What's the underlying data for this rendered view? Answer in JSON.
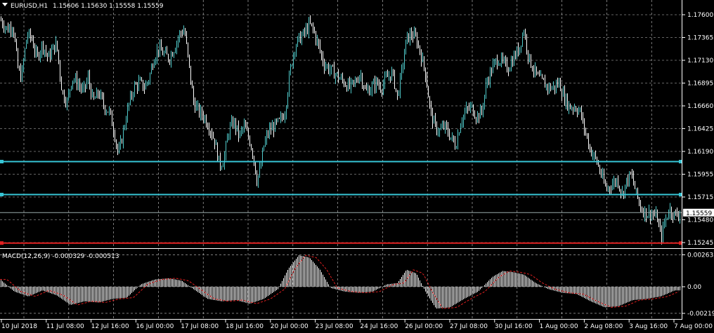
{
  "window": {
    "symbol_label": "EURUSD,H1",
    "ohlc": "1.15606 1.15630 1.15558 1.15559",
    "menu_icon": "triangle-down-icon",
    "bid_label": "1.15559"
  },
  "colors": {
    "background": "#000000",
    "grid": "#c8c8c8",
    "bull_candle": "#4fc9c9",
    "bear_candle": "#ffffff",
    "hline_cyan": "#37c6d6",
    "hline_red": "#e02020",
    "histogram": "#ffffff",
    "signal": "#e02020"
  },
  "price_axis": {
    "ticks": [
      "1.17600",
      "1.17365",
      "1.17130",
      "1.16895",
      "1.16660",
      "1.16425",
      "1.16190",
      "1.15955",
      "1.15715",
      "1.15480",
      "1.15245"
    ]
  },
  "horizontal_lines": [
    {
      "name": "hline-1",
      "price": 1.16085
    },
    {
      "name": "hline-2",
      "price": 1.15745
    },
    {
      "name": "hline-3",
      "price": 1.15245
    }
  ],
  "indicator": {
    "label": "MACD(12,26,9) -0.000329 -0.000513",
    "ticks": [
      "0.002633",
      "0.00",
      "-0.002194"
    ]
  },
  "time_axis": {
    "labels": [
      "10 Jul 2018",
      "11 Jul 08:00",
      "12 Jul 16:00",
      "16 Jul 00:00",
      "17 Jul 08:00",
      "18 Jul 16:00",
      "20 Jul 00:00",
      "23 Jul 08:00",
      "24 Jul 16:00",
      "26 Jul 00:00",
      "27 Jul 08:00",
      "30 Jul 16:00",
      "1 Aug 00:00",
      "2 Aug 08:00",
      "3 Aug 16:00",
      "7 Aug 00:00"
    ]
  },
  "price_path": [
    [
      0,
      1.1755
    ],
    [
      10,
      1.1745
    ],
    [
      18,
      1.175
    ],
    [
      25,
      1.1705
    ],
    [
      30,
      1.1695
    ],
    [
      38,
      1.174
    ],
    [
      45,
      1.1735
    ],
    [
      52,
      1.1715
    ],
    [
      60,
      1.173
    ],
    [
      68,
      1.1715
    ],
    [
      75,
      1.1725
    ],
    [
      80,
      1.173
    ],
    [
      88,
      1.168
    ],
    [
      95,
      1.167
    ],
    [
      102,
      1.1695
    ],
    [
      110,
      1.169
    ],
    [
      118,
      1.168
    ],
    [
      125,
      1.1695
    ],
    [
      132,
      1.167
    ],
    [
      140,
      1.168
    ],
    [
      148,
      1.1665
    ],
    [
      155,
      1.166
    ],
    [
      162,
      1.164
    ],
    [
      168,
      1.1615
    ],
    [
      175,
      1.164
    ],
    [
      182,
      1.1665
    ],
    [
      190,
      1.1685
    ],
    [
      198,
      1.169
    ],
    [
      205,
      1.1685
    ],
    [
      212,
      1.1695
    ],
    [
      218,
      1.1715
    ],
    [
      225,
      1.1725
    ],
    [
      232,
      1.172
    ],
    [
      240,
      1.1715
    ],
    [
      247,
      1.1725
    ],
    [
      255,
      1.174
    ],
    [
      262,
      1.1745
    ],
    [
      268,
      1.171
    ],
    [
      275,
      1.167
    ],
    [
      282,
      1.166
    ],
    [
      290,
      1.1655
    ],
    [
      297,
      1.1645
    ],
    [
      305,
      1.163
    ],
    [
      312,
      1.1605
    ],
    [
      318,
      1.161
    ],
    [
      325,
      1.164
    ],
    [
      332,
      1.165
    ],
    [
      340,
      1.1635
    ],
    [
      347,
      1.1645
    ],
    [
      355,
      1.163
    ],
    [
      360,
      1.1615
    ],
    [
      365,
      1.159
    ],
    [
      370,
      1.16
    ],
    [
      375,
      1.1625
    ],
    [
      382,
      1.164
    ],
    [
      390,
      1.1645
    ],
    [
      398,
      1.165
    ],
    [
      405,
      1.166
    ],
    [
      412,
      1.17
    ],
    [
      418,
      1.1725
    ],
    [
      425,
      1.1735
    ],
    [
      432,
      1.174
    ],
    [
      440,
      1.175
    ],
    [
      445,
      1.1745
    ],
    [
      452,
      1.173
    ],
    [
      460,
      1.171
    ],
    [
      467,
      1.1705
    ],
    [
      475,
      1.17
    ],
    [
      482,
      1.1695
    ],
    [
      490,
      1.169
    ],
    [
      497,
      1.1685
    ],
    [
      505,
      1.169
    ],
    [
      512,
      1.17
    ],
    [
      520,
      1.168
    ],
    [
      528,
      1.1685
    ],
    [
      535,
      1.169
    ],
    [
      542,
      1.1685
    ],
    [
      550,
      1.1695
    ],
    [
      558,
      1.17
    ],
    [
      565,
      1.1675
    ],
    [
      572,
      1.1705
    ],
    [
      578,
      1.1735
    ],
    [
      585,
      1.174
    ],
    [
      592,
      1.1735
    ],
    [
      598,
      1.172
    ],
    [
      605,
      1.17
    ],
    [
      612,
      1.166
    ],
    [
      618,
      1.1645
    ],
    [
      625,
      1.164
    ],
    [
      632,
      1.1645
    ],
    [
      640,
      1.1635
    ],
    [
      648,
      1.1625
    ],
    [
      655,
      1.165
    ],
    [
      662,
      1.166
    ],
    [
      670,
      1.1665
    ],
    [
      678,
      1.1655
    ],
    [
      685,
      1.166
    ],
    [
      692,
      1.169
    ],
    [
      700,
      1.1705
    ],
    [
      708,
      1.1715
    ],
    [
      715,
      1.171
    ],
    [
      722,
      1.1705
    ],
    [
      730,
      1.1715
    ],
    [
      738,
      1.1725
    ],
    [
      745,
      1.1745
    ],
    [
      752,
      1.1715
    ],
    [
      758,
      1.1705
    ],
    [
      765,
      1.1695
    ],
    [
      772,
      1.169
    ],
    [
      780,
      1.1685
    ],
    [
      788,
      1.1685
    ],
    [
      795,
      1.169
    ],
    [
      802,
      1.1675
    ],
    [
      810,
      1.1665
    ],
    [
      818,
      1.1665
    ],
    [
      825,
      1.166
    ],
    [
      832,
      1.164
    ],
    [
      840,
      1.162
    ],
    [
      848,
      1.161
    ],
    [
      855,
      1.1595
    ],
    [
      862,
      1.158
    ],
    [
      870,
      1.1585
    ],
    [
      878,
      1.159
    ],
    [
      885,
      1.1575
    ],
    [
      892,
      1.159
    ],
    [
      898,
      1.1595
    ],
    [
      905,
      1.1575
    ],
    [
      912,
      1.156
    ],
    [
      920,
      1.1555
    ],
    [
      928,
      1.1555
    ],
    [
      935,
      1.155
    ],
    [
      940,
      1.153
    ],
    [
      945,
      1.1545
    ],
    [
      952,
      1.156
    ],
    [
      960,
      1.1553
    ],
    [
      968,
      1.1556
    ]
  ],
  "macd_path": [
    [
      0,
      0.0006
    ],
    [
      20,
      -0.0004
    ],
    [
      40,
      -0.0008
    ],
    [
      60,
      -0.0003
    ],
    [
      80,
      -0.0007
    ],
    [
      100,
      -0.0015
    ],
    [
      120,
      -0.0012
    ],
    [
      140,
      -0.0013
    ],
    [
      160,
      -0.001
    ],
    [
      180,
      -0.0009
    ],
    [
      200,
      0.0002
    ],
    [
      220,
      0.0006
    ],
    [
      240,
      0.0007
    ],
    [
      258,
      0.0005
    ],
    [
      275,
      -0.0002
    ],
    [
      295,
      -0.001
    ],
    [
      315,
      -0.0012
    ],
    [
      335,
      -0.0011
    ],
    [
      355,
      -0.0014
    ],
    [
      375,
      -0.001
    ],
    [
      395,
      -0.0002
    ],
    [
      410,
      0.0015
    ],
    [
      425,
      0.0026
    ],
    [
      440,
      0.0024
    ],
    [
      455,
      0.0014
    ],
    [
      470,
      -0.0001
    ],
    [
      490,
      -0.0004
    ],
    [
      510,
      -0.0005
    ],
    [
      530,
      -0.0004
    ],
    [
      550,
      0.0002
    ],
    [
      565,
      0.0003
    ],
    [
      578,
      0.0014
    ],
    [
      592,
      0.0011
    ],
    [
      605,
      -0.0004
    ],
    [
      620,
      -0.0018
    ],
    [
      640,
      -0.0017
    ],
    [
      660,
      -0.001
    ],
    [
      680,
      -0.0004
    ],
    [
      700,
      0.0008
    ],
    [
      715,
      0.0013
    ],
    [
      730,
      0.0012
    ],
    [
      745,
      0.001
    ],
    [
      762,
      0.0003
    ],
    [
      780,
      -0.0002
    ],
    [
      800,
      -0.0005
    ],
    [
      820,
      -0.0006
    ],
    [
      840,
      -0.0012
    ],
    [
      860,
      -0.0017
    ],
    [
      880,
      -0.0016
    ],
    [
      900,
      -0.0011
    ],
    [
      920,
      -0.001
    ],
    [
      940,
      -0.0008
    ],
    [
      960,
      -0.0003
    ],
    [
      968,
      -0.0003
    ]
  ]
}
